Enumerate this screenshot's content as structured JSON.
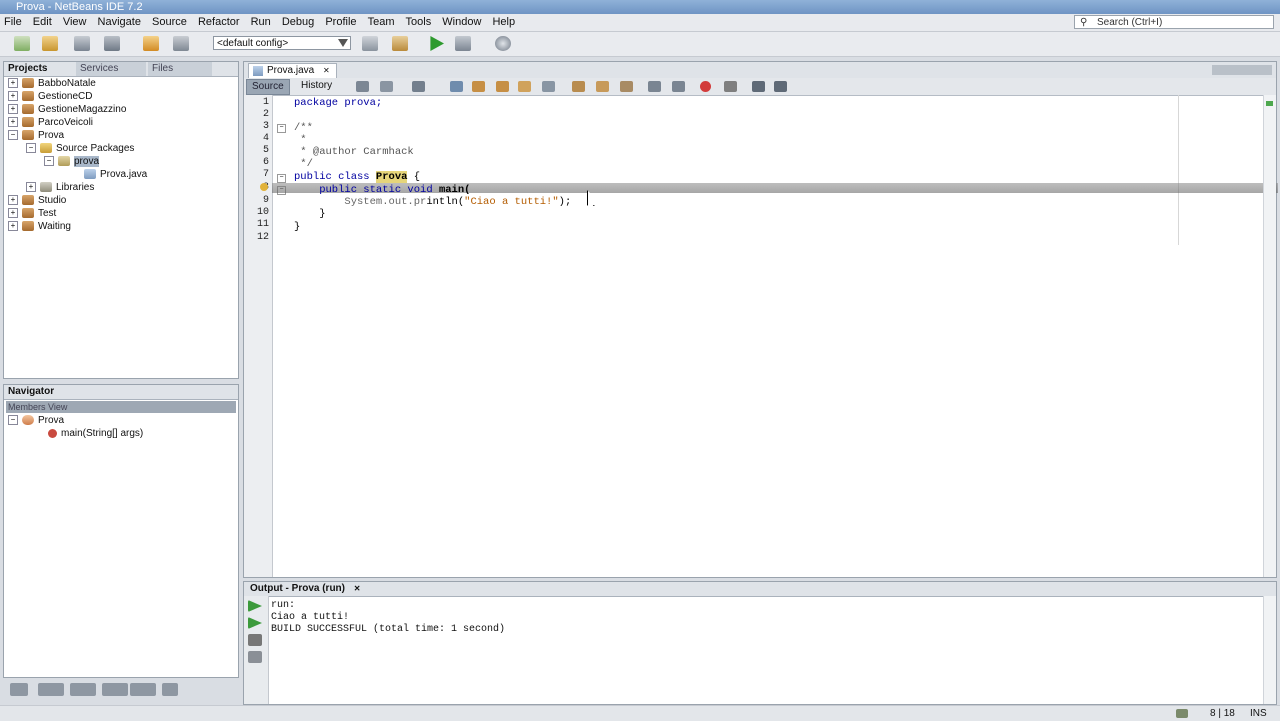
{
  "window": {
    "title": "Prova - NetBeans IDE 7.2"
  },
  "menu": [
    "File",
    "Edit",
    "View",
    "Navigate",
    "Source",
    "Refactor",
    "Run",
    "Debug",
    "Profile",
    "Team",
    "Tools",
    "Window",
    "Help"
  ],
  "search": {
    "placeholder": "Search (Ctrl+I)"
  },
  "toolbar": {
    "config": "<default config>"
  },
  "projects_panel": {
    "tabs": [
      "Projects",
      "Services",
      "Files"
    ],
    "tree": [
      {
        "label": "BabboNatale",
        "icon": "project-icon"
      },
      {
        "label": "GestioneCD",
        "icon": "project-icon"
      },
      {
        "label": "GestioneMagazzino",
        "icon": "project-icon"
      },
      {
        "label": "ParcoVeicoli",
        "icon": "project-icon"
      },
      {
        "label": "Prova",
        "icon": "project-icon"
      },
      {
        "label": "Source Packages",
        "icon": "source-packages-icon"
      },
      {
        "label": "prova",
        "icon": "package-icon"
      },
      {
        "label": "Prova.java",
        "icon": "java-file-icon"
      },
      {
        "label": "Libraries",
        "icon": "libraries-icon"
      },
      {
        "label": "Studio",
        "icon": "project-icon"
      },
      {
        "label": "Test",
        "icon": "project-icon"
      },
      {
        "label": "Waiting",
        "icon": "project-icon"
      }
    ]
  },
  "navigator": {
    "title": "Navigator",
    "view": "Members View",
    "class": "Prova",
    "method": "main(String[] args)"
  },
  "editor": {
    "file_tab": "Prova.java",
    "tabs": [
      "Source",
      "History"
    ],
    "line_numbers": [
      "1",
      "2",
      "3",
      "4",
      "5",
      "6",
      "7",
      "8",
      "9",
      "10",
      "11",
      "12"
    ],
    "code": {
      "l1": "package prova;",
      "l3": "/**",
      "l4": " *",
      "l5": " * @author Carmhack",
      "l6": " */",
      "l7a": "public class ",
      "l7b": "Prova",
      "l7c": " {",
      "l8a": "    public static void ",
      "l8b": "main(",
      "l9a": "        System.out.pr",
      "l9b": "intln(",
      "l9c": "\"Ciao a tutti!\"",
      "l9d": ");",
      "l10": "    }",
      "l11": "}"
    }
  },
  "output": {
    "title": "Output - Prova (run)",
    "lines": [
      "run:",
      "Ciao a tutti!",
      "BUILD SUCCESSFUL (total time: 1 second)"
    ]
  },
  "status": {
    "position": "8 | 18",
    "mode": "INS"
  }
}
